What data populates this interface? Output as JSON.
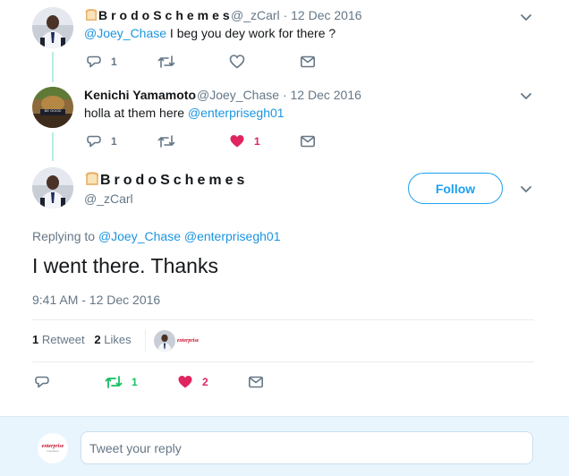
{
  "tweet1": {
    "display_name": "BrodoSchemes",
    "handle": "@_zCarl",
    "dot": "·",
    "date": "12 Dec 2016",
    "mention": "@Joey_Chase",
    "text": " I beg you dey work for there ?",
    "reply_count": "1",
    "retweet_count": "",
    "like_count": ""
  },
  "tweet2": {
    "display_name": "Kenichi Yamamoto",
    "handle": "@Joey_Chase",
    "dot": "·",
    "date": "12 Dec 2016",
    "text": "holla at them here ",
    "mention": "@enterprisegh01",
    "reply_count": "1",
    "like_count": "1",
    "avatar_sign_text": "BE GOOD"
  },
  "main_tweet": {
    "display_name": "BrodoSchemes",
    "handle": "@_zCarl",
    "follow_label": "Follow",
    "replying_to_label": "Replying to",
    "replying_to_1": "@Joey_Chase",
    "replying_to_2": "@enterprisegh01",
    "text": "I went there. Thanks",
    "timestamp": "9:41 AM - 12 Dec 2016",
    "retweets_num": "1",
    "retweets_label": "Retweet",
    "likes_num": "2",
    "likes_label": "Likes",
    "liker_logo_text": "enterprise",
    "retweet_count": "1",
    "like_count": "2"
  },
  "reply_bar": {
    "placeholder": "Tweet your reply",
    "avatar_logo_text": "enterprise",
    "avatar_sub_text": "insurance"
  },
  "colors": {
    "link": "#1b95e0",
    "like": "#e0245e",
    "retweet": "#17bf63",
    "icon": "#657786",
    "thread_line": "#b8ece3"
  },
  "icons": {
    "emoji": "bread-emoji",
    "reply": "reply-icon",
    "retweet": "retweet-icon",
    "like": "heart-icon",
    "dm": "envelope-icon",
    "more": "chevron-down-icon"
  }
}
